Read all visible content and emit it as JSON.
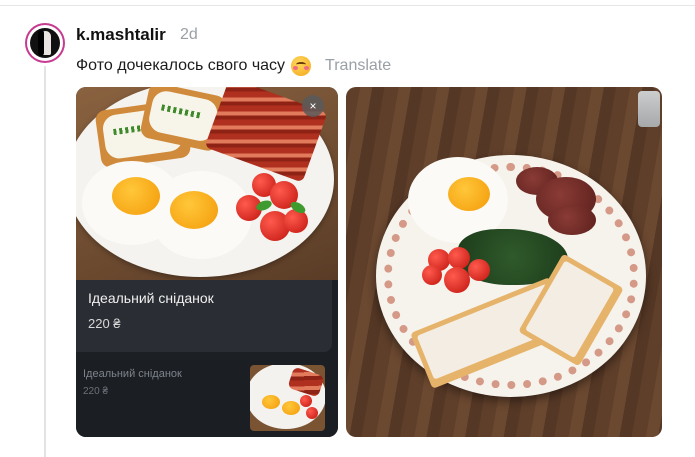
{
  "post": {
    "username": "k.mashtalir",
    "age": "2d",
    "caption": "Фото дочекалось свого часу",
    "emoji": "smiling-face-with-heart-eyes",
    "translate_label": "Translate"
  },
  "media_left": {
    "product_title": "Ідеальний сніданок",
    "product_price": "220 ₴",
    "related_title": "Ідеальний сніданок",
    "related_price": "220 ₴",
    "close_label": "×"
  },
  "icons": {
    "close": "close-icon"
  }
}
